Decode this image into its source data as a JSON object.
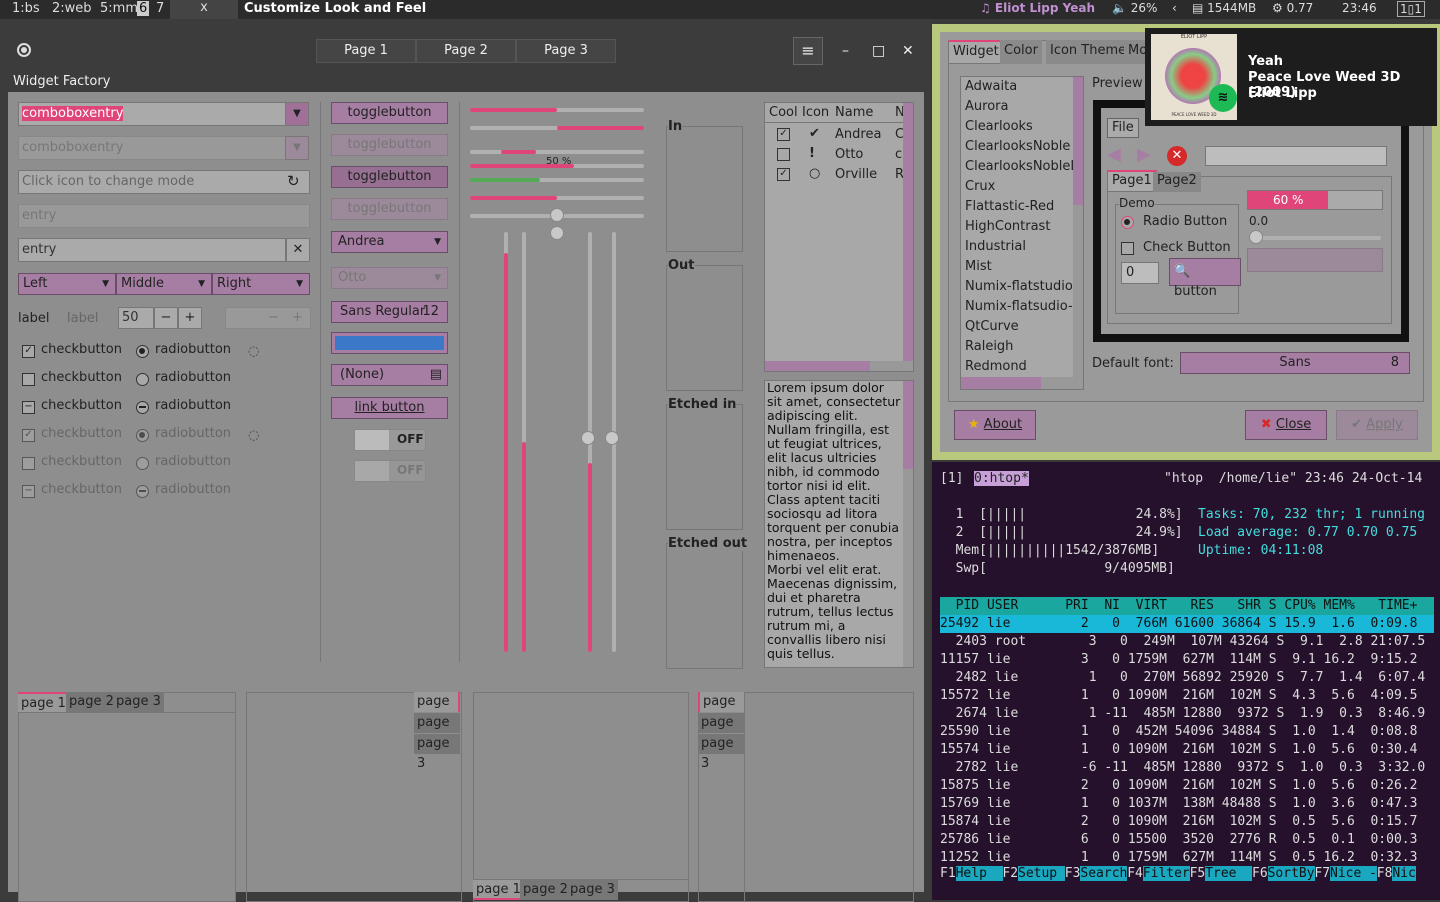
{
  "topbar": {
    "workspaces": [
      "1:bs",
      "2:web",
      "5:mm",
      "6",
      "7"
    ],
    "active_ws": "6",
    "close": "x",
    "title": "Customize Look and Feel",
    "music": "♫ Eliot Lipp Yeah",
    "volume": "🔈 26%",
    "arrow": "‹",
    "mem": "▤ 1544MB",
    "load": "⚙ 0.77",
    "time": "23:46",
    "layout": "1▯1"
  },
  "win1": {
    "page_tabs": [
      "Page 1",
      "Page 2",
      "Page 3"
    ],
    "menu_icon": "≡",
    "min": "–",
    "max": "□",
    "close": "✕",
    "section": "Widget Factory"
  },
  "col1": {
    "combo1": "comboboxentry",
    "combo2": "comboboxentry",
    "icon_entry_placeholder": "Click icon to change mode",
    "entry_dis": "entry",
    "entry": "entry",
    "seg": [
      "Left",
      "Middle",
      "Right"
    ],
    "label1": "label",
    "label2": "label",
    "spin": "50",
    "spin_minus": "−",
    "spin_plus": "+",
    "checks": [
      {
        "c": "checkbutton",
        "r": "radiobutton"
      },
      {
        "c": "checkbutton",
        "r": "radiobutton"
      },
      {
        "c": "checkbutton",
        "r": "radiobutton"
      },
      {
        "c": "checkbutton",
        "r": "radiobutton"
      },
      {
        "c": "checkbutton",
        "r": "radiobutton"
      },
      {
        "c": "checkbutton",
        "r": "radiobutton"
      }
    ]
  },
  "col2": {
    "toggles": [
      "togglebutton",
      "togglebutton",
      "togglebutton",
      "togglebutton"
    ],
    "combo_andrea": "Andrea",
    "combo_otto": "Otto",
    "font": "Sans Regular",
    "font_size": "12",
    "file": "(None)",
    "link": "link button",
    "switch1": "OFF",
    "switch2": "OFF"
  },
  "scales": {
    "percent_label": "50 %",
    "progress": [
      0.5,
      0.5,
      0.2,
      0.6,
      0.4,
      0.5,
      0.0
    ],
    "vprogress": [
      0.95,
      0.7,
      0.0,
      0.45,
      0.0,
      0.0
    ]
  },
  "frames": [
    "In",
    "Out",
    "Etched in",
    "Etched out"
  ],
  "tree": {
    "headers": [
      "Cool",
      "Icon",
      "Name",
      "N"
    ],
    "rows": [
      {
        "cool": true,
        "icon": "✔",
        "name": "Andrea",
        "n": "C"
      },
      {
        "cool": false,
        "icon": "!",
        "name": "Otto",
        "n": "c"
      },
      {
        "cool": true,
        "icon": "○",
        "name": "Orville",
        "n": "R"
      }
    ]
  },
  "lorem": "Lorem ipsum dolor sit amet, consectetur adipiscing elit.\nNullam fringilla, est ut feugiat ultrices, elit lacus ultricies nibh, id commodo tortor nisi id elit.\nClass aptent taciti sociosqu ad litora torquent per conubia nostra, per inceptos himenaeos.\nMorbi vel elit erat. Maecenas dignissim, dui et pharetra rutrum, tellus lectus rutrum mi, a convallis libero nisi quis tellus.",
  "notebooks": {
    "tabs": [
      "page 1",
      "page 2",
      "page 3"
    ]
  },
  "lxap": {
    "tabs": [
      "Widget",
      "Color",
      "Icon Theme",
      "Mo"
    ],
    "themes": [
      "Adwaita",
      "Aurora",
      "Clearlooks",
      "ClearlooksNoble",
      "ClearlooksNobleD",
      "Crux",
      "Flattastic-Red",
      "HighContrast",
      "Industrial",
      "Mist",
      "Numix-flatstudio",
      "Numix-flatsudio-d",
      "QtCurve",
      "Raleigh",
      "Redmond"
    ],
    "preview": "Preview",
    "file_menu": "File",
    "page1": "Page1",
    "page2": "Page2",
    "demo": "Demo",
    "radio": "Radio Button",
    "check": "Check Button",
    "progress": "60 %",
    "scale_val": "0.0",
    "spin": "0",
    "button": "button",
    "default_font": "Default font:",
    "font": "Sans",
    "font_size": "8",
    "about": "About",
    "close": "Close",
    "apply": "Apply"
  },
  "notif": {
    "line1": "Yeah",
    "line2": "Peace Love Weed 3D (2009)",
    "line3": "Eliot Lipp",
    "album_top": "ELIOT LIPP",
    "album_bottom": "PEACE LOVE WEED 3D"
  },
  "htop": {
    "tab": "[1]",
    "tabname": "0:htop*",
    "title": "\"htop  /home/lie\" 23:46 24-Oct-14",
    "cpu1": "  1  [|||||              24.8%]",
    "cpu2": "  2  [|||||              24.9%]",
    "mem": "  Mem[||||||||||1542/3876MB]",
    "swp": "  Swp[               9/4095MB]",
    "tasks": "Tasks: 70, 232 thr; 1 running",
    "load": "Load average: 0.77 0.70 0.75",
    "uptime": "Uptime: 04:11:08",
    "header": "  PID USER      PRI  NI  VIRT   RES   SHR S CPU% MEM%   TIME+",
    "rows": [
      "25492 lie         2   0  766M 61600 36864 S 15.9  1.6  0:09.8",
      "  2403 root        3   0  249M  107M 43264 S  9.1  2.8 21:07.5",
      "11157 lie         3   0 1759M  627M  114M S  9.1 16.2  9:15.2",
      "  2482 lie         1   0  270M 56892 25920 S  7.7  1.4  6:07.4",
      "15572 lie         1   0 1090M  216M  102M S  4.3  5.6  4:09.5",
      "  2674 lie         1 -11  485M 12880  9372 S  1.9  0.3  8:46.9",
      "25590 lie         1   0  452M 54096 34884 S  1.0  1.4  0:08.8",
      "15574 lie         1   0 1090M  216M  102M S  1.0  5.6  0:30.4",
      "  2782 lie        -6 -11  485M 12880  9372 S  1.0  0.3  3:32.0",
      "15875 lie         2   0 1090M  216M  102M S  1.0  5.6  0:26.2",
      "15769 lie         1   0 1037M  138M 48488 S  1.0  3.6  0:47.3",
      "15874 lie         2   0 1090M  216M  102M S  0.5  5.6  0:15.7",
      "25786 lie         6   0 15500  3520  2776 R  0.5  0.1  0:00.3",
      "11252 lie         1   0 1759M  627M  114M S  0.5 16.2  0:32.3"
    ],
    "fkeys": [
      [
        "F1",
        "Help  "
      ],
      [
        "F2",
        "Setup "
      ],
      [
        "F3",
        "Search"
      ],
      [
        "F4",
        "Filter"
      ],
      [
        "F5",
        "Tree  "
      ],
      [
        "F6",
        "SortBy"
      ],
      [
        "F7",
        "Nice -"
      ],
      [
        "F8",
        "Nic"
      ]
    ]
  }
}
